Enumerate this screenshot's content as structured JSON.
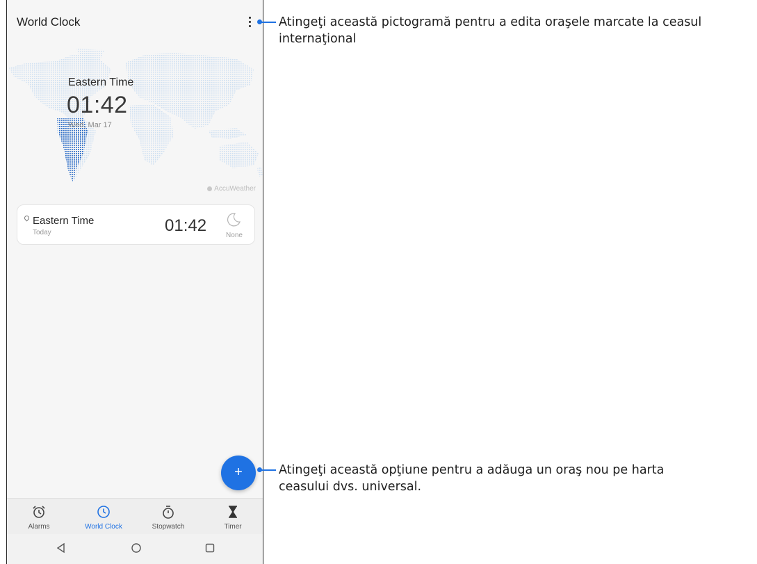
{
  "header": {
    "title": "World Clock"
  },
  "map_panel": {
    "zone": "Eastern Time",
    "time": "01:42",
    "date": "Wed, Mar 17",
    "attribution": "AccuWeather"
  },
  "clock_list": [
    {
      "city": "Eastern Time",
      "day": "Today",
      "time": "01:42",
      "weather": "None",
      "weather_icon": "moon-icon"
    }
  ],
  "fab": {
    "label": "+"
  },
  "bottom_nav": [
    {
      "label": "Alarms",
      "icon": "alarm-icon",
      "active": false
    },
    {
      "label": "World Clock",
      "icon": "clock-icon",
      "active": true
    },
    {
      "label": "Stopwatch",
      "icon": "stopwatch-icon",
      "active": false
    },
    {
      "label": "Timer",
      "icon": "hourglass-icon",
      "active": false
    }
  ],
  "system_nav": [
    "back-icon",
    "home-icon",
    "recents-icon"
  ],
  "callouts": {
    "menu": {
      "line1": "Atingeţi această pictogramă pentru a edita oraşele marcate la ceasul",
      "line2": "internaţional"
    },
    "add": {
      "line1": "Atingeţi această opţiune pentru a adăuga un oraş nou pe harta",
      "line2": "ceasului dvs. universal."
    }
  },
  "colors": {
    "accent": "#1f72e3",
    "map_dots": "#cfe0f1",
    "night_region": "#2f6fc7"
  }
}
